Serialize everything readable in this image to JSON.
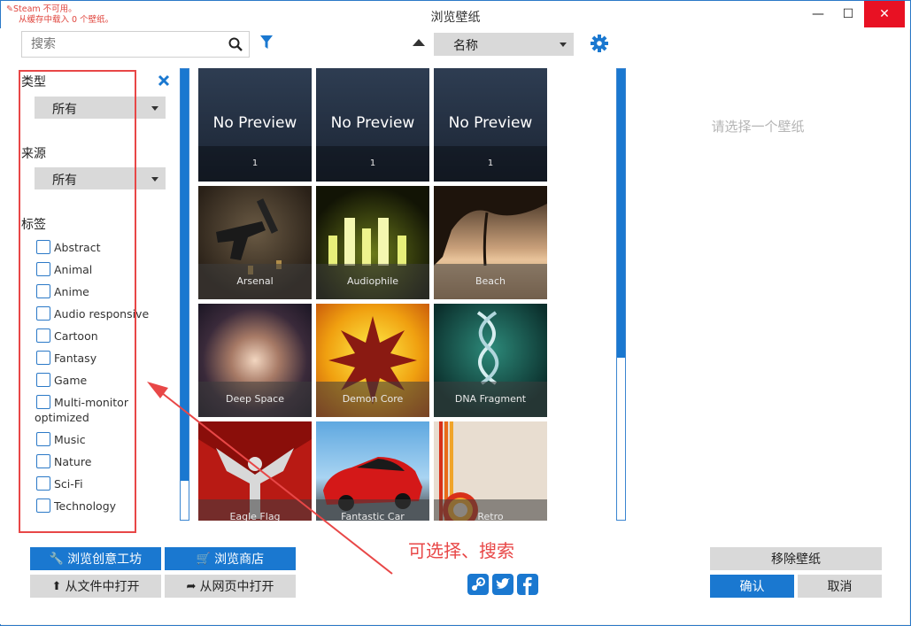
{
  "window": {
    "title": "浏览壁纸",
    "steam_warning_line1": "Steam 不可用。",
    "steam_warning_line2": "从缓存中载入 0 个壁纸。",
    "minimize_glyph": "—",
    "maximize_glyph": "☐",
    "close_glyph": "✕"
  },
  "toolbar": {
    "search_placeholder": "搜索",
    "sort_value": "名称"
  },
  "filters": {
    "type_label": "类型",
    "type_value": "所有",
    "source_label": "来源",
    "source_value": "所有",
    "tags_label": "标签",
    "tags": [
      "Abstract",
      "Animal",
      "Anime",
      "Audio responsive",
      "Cartoon",
      "Fantasy",
      "Game",
      "Multi-monitor",
      "Music",
      "Nature",
      "Sci-Fi",
      "Technology"
    ],
    "tag_multimonitor_line2": "optimized"
  },
  "grid": {
    "no_preview_text": "No Preview",
    "no_preview_items": [
      "1",
      "1",
      "1"
    ],
    "items": [
      "Arsenal",
      "Audiophile",
      "Beach",
      "Deep Space",
      "Demon Core",
      "DNA Fragment",
      "Eagle Flag",
      "Fantastic Car",
      "Retro"
    ]
  },
  "right_panel": {
    "placeholder": "请选择一个壁纸"
  },
  "buttons": {
    "workshop": "浏览创意工坊",
    "store": "浏览商店",
    "open_file": "从文件中打开",
    "open_web": "从网页中打开",
    "remove": "移除壁纸",
    "ok": "确认",
    "cancel": "取消"
  },
  "annotation": {
    "text": "可选择、搜索"
  },
  "colors": {
    "accent": "#1a78d0",
    "annotation": "#e84747"
  }
}
